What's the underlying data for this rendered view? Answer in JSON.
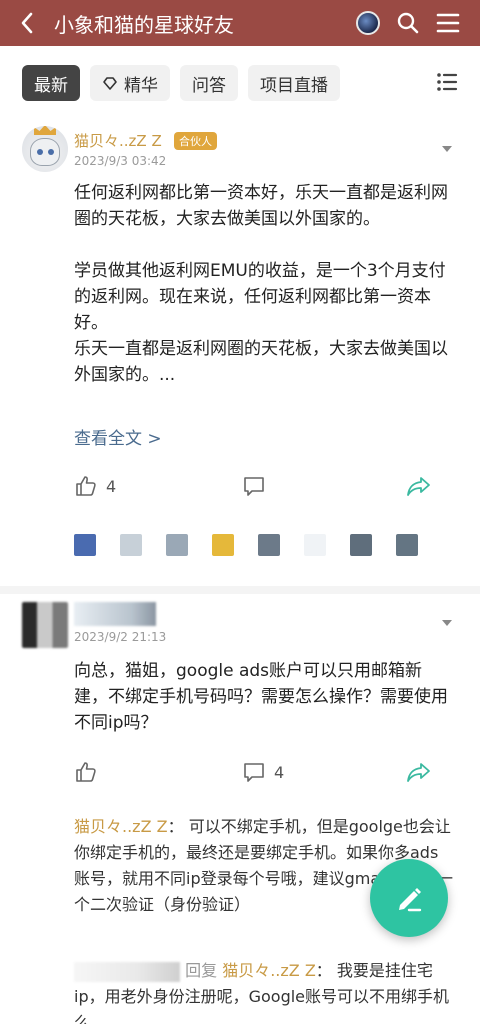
{
  "header": {
    "title": "小象和猫的星球好友",
    "back_icon": "chevron-left-icon",
    "planet_icon": "planet-avatar-icon",
    "search_icon": "search-icon",
    "menu_icon": "menu-icon"
  },
  "tabs": [
    {
      "label": "最新",
      "active": true
    },
    {
      "label": "精华",
      "icon": "heart-diamond-icon"
    },
    {
      "label": "问答"
    },
    {
      "label": "项目直播"
    }
  ],
  "posts": [
    {
      "author": "猫贝々..zZ Z",
      "badge": "合伙人",
      "date": "2023/9/3 03:42",
      "paragraphs": [
        "任何返利网都比第一资本好，乐天一直都是返利网圈的天花板，大家去做美国以外国家的。",
        "学员做其他返利网EMU的收益，是一个3个月支付的返利网。现在来说，任何返利网都比第一资本好。",
        "乐天一直都是返利网圈的天花板，大家去做美国以外国家的。..."
      ],
      "more": "查看全文 >",
      "like_count": "4",
      "comment_count": ""
    },
    {
      "author": "",
      "date": "2023/9/2 21:13",
      "text": "向总，猫姐，google ads账户可以只用邮箱新建，不绑定手机号码吗？需要怎么操作？需要使用不同ip吗？",
      "like_count": "",
      "comment_count": "4",
      "replies": [
        {
          "name": "猫贝々..zZ Z",
          "sep": "：",
          "text": "可以不绑定手机，但是goolge也会让你绑定手机的，最终还是要绑定手机。如果你多ads账号，就用不同ip登录每个号哦，建议gmail邮箱做一个二次验证（身份验证）"
        },
        {
          "reply_label": "回复",
          "name": "猫贝々..zZ Z",
          "sep": "：",
          "text": "我要是挂住宅ip，用老外身份注册呢，Google账号可以不用绑手机么"
        }
      ]
    }
  ],
  "likers_colors": [
    "#4a6bb0",
    "#c7d0d8",
    "#9aa8b6",
    "#e5b83a",
    "#6c7a89",
    "#f0f3f6",
    "#5f6e7c",
    "#647583"
  ],
  "fab_icon": "pencil-edit-icon",
  "colors": {
    "header_bg": "#9a4a44",
    "accent_gold": "#c89a45",
    "link_blue": "#4a6b8e",
    "fab_green": "#2ec4a2"
  }
}
